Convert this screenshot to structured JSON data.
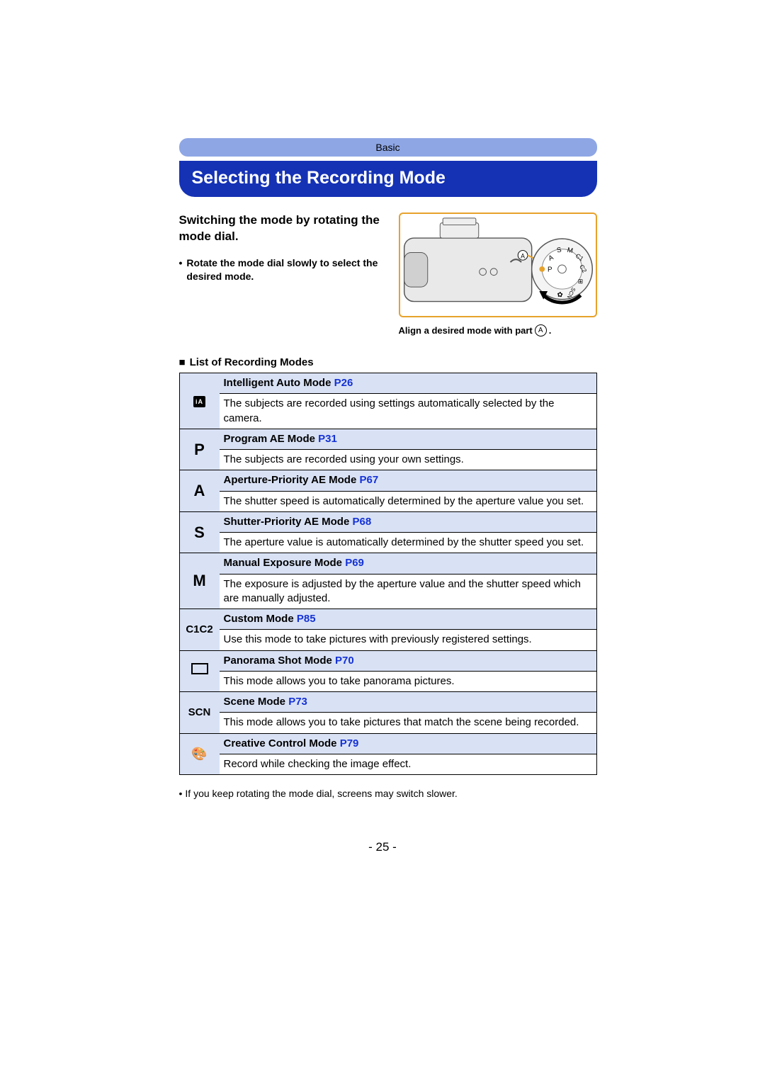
{
  "breadcrumb": "Basic",
  "title": "Selecting the Recording Mode",
  "instruction": {
    "heading": "Switching the mode by rotating the mode dial.",
    "bullet": "Rotate the mode dial slowly to select the desired mode."
  },
  "figure": {
    "caption_prefix": "Align a desired mode with part ",
    "marker": "A",
    "caption_suffix": "."
  },
  "list_heading": "List of Recording Modes",
  "modes": [
    {
      "icon_type": "ia",
      "icon": "iA",
      "name": "Intelligent Auto Mode",
      "page": "P26",
      "desc": "The subjects are recorded using settings automatically selected by the camera."
    },
    {
      "icon_type": "big",
      "icon": "P",
      "name": "Program AE Mode",
      "page": "P31",
      "desc": "The subjects are recorded using your own settings."
    },
    {
      "icon_type": "big",
      "icon": "A",
      "name": "Aperture-Priority AE Mode",
      "page": "P67",
      "desc": "The shutter speed is automatically determined by the aperture value you set."
    },
    {
      "icon_type": "big",
      "icon": "S",
      "name": "Shutter-Priority AE Mode",
      "page": "P68",
      "desc": "The aperture value is automatically determined by the shutter speed you set."
    },
    {
      "icon_type": "big",
      "icon": "M",
      "name": "Manual Exposure Mode",
      "page": "P69",
      "desc": "The exposure is adjusted by the aperture value and the shutter speed which are manually adjusted."
    },
    {
      "icon_type": "small",
      "icon": "C1C2",
      "name": "Custom Mode",
      "page": "P85",
      "desc": "Use this mode to take pictures with previously registered settings."
    },
    {
      "icon_type": "pano",
      "icon": "",
      "name": "Panorama Shot Mode",
      "page": "P70",
      "desc": "This mode allows you to take panorama pictures."
    },
    {
      "icon_type": "small",
      "icon": "SCN",
      "name": "Scene Mode",
      "page": "P73",
      "desc": "This mode allows you to take pictures that match the scene being recorded."
    },
    {
      "icon_type": "palette",
      "icon": "",
      "name": "Creative Control Mode",
      "page": "P79",
      "desc": "Record while checking the image effect."
    }
  ],
  "footnote": "If you keep rotating the mode dial, screens may switch slower.",
  "page_number": "- 25 -"
}
